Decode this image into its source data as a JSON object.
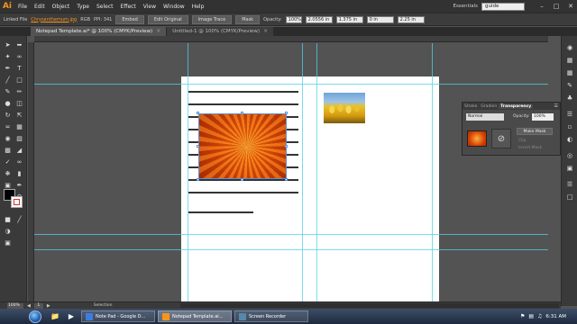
{
  "app": {
    "logo": "Ai"
  },
  "menu": {
    "items": [
      "File",
      "Edit",
      "Object",
      "Type",
      "Select",
      "Effect",
      "View",
      "Window",
      "Help"
    ]
  },
  "header": {
    "workspace": "Essentials",
    "search_value": "guide"
  },
  "control_bar": {
    "linked_file_label": "Linked File",
    "file_name": "Chrysanthemum.jpg",
    "color_mode": "RGB",
    "ppi": "PPI: 341",
    "embed_label": "Embed",
    "edit_original_label": "Edit Original",
    "image_trace_label": "Image Trace",
    "mask_label": "Mask",
    "opacity_label": "Opacity:",
    "opacity_value": "100%",
    "x_value": "2.0556 in",
    "y_value": "1.375 in",
    "w_value": "0 in",
    "h_value": "2.25 in"
  },
  "tabs": [
    {
      "label": "Notepad Template.ai* @ 100% (CMYK/Preview)",
      "active": true
    },
    {
      "label": "Untitled-1 @ 100% (CMYK/Preview)",
      "active": false
    }
  ],
  "transparency_panel": {
    "tabs": [
      "Stroke",
      "Gradien",
      "Transparency"
    ],
    "blend_mode": "Normal",
    "opacity_label": "Opacity:",
    "opacity_value": "100%",
    "make_mask_label": "Make Mask",
    "clip_label": "Clip",
    "invert_mask_label": "Invert Mask"
  },
  "status_bar": {
    "zoom": "100%",
    "page": "1",
    "tool": "Selection"
  },
  "taskbar": {
    "items": [
      {
        "label": "Note Pad - Google D...",
        "active": false
      },
      {
        "label": "Notepad Template.ai...",
        "active": true
      },
      {
        "label": "Screen Recorder",
        "active": false
      }
    ],
    "time": "6:31 AM"
  },
  "colors": {
    "accent": "#f7941d",
    "guide": "#4fd2e6",
    "selection": "#5b8fd6",
    "canvas": "#535353"
  },
  "icons": [
    "selection-tool-icon",
    "direct-selection-tool-icon",
    "pen-tool-icon",
    "type-tool-icon",
    "rectangle-tool-icon",
    "zoom-tool-icon",
    "hand-tool-icon"
  ]
}
